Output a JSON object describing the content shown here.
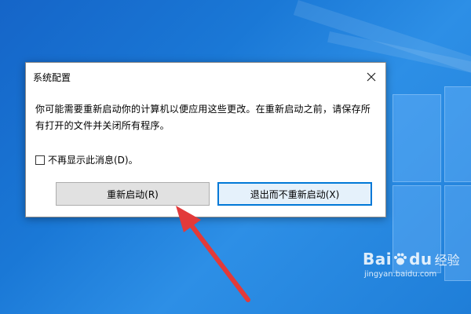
{
  "dialog": {
    "title": "系统配置",
    "message": "你可能需要重新启动你的计算机以便应用这些更改。在重新启动之前，请保存所有打开的文件并关闭所有程序。",
    "checkbox_label": "不再显示此消息(D)。",
    "checkbox_checked": false,
    "restart_button": "重新启动(R)",
    "exit_button": "退出而不重新启动(X)"
  },
  "watermark": {
    "brand_prefix": "Bai",
    "brand_suffix": "du",
    "product": "经验",
    "url": "jingyan.baidu.com"
  },
  "colors": {
    "desktop_blue": "#1a78d6",
    "focus_border": "#0078d7",
    "arrow": "#e23a3a"
  }
}
